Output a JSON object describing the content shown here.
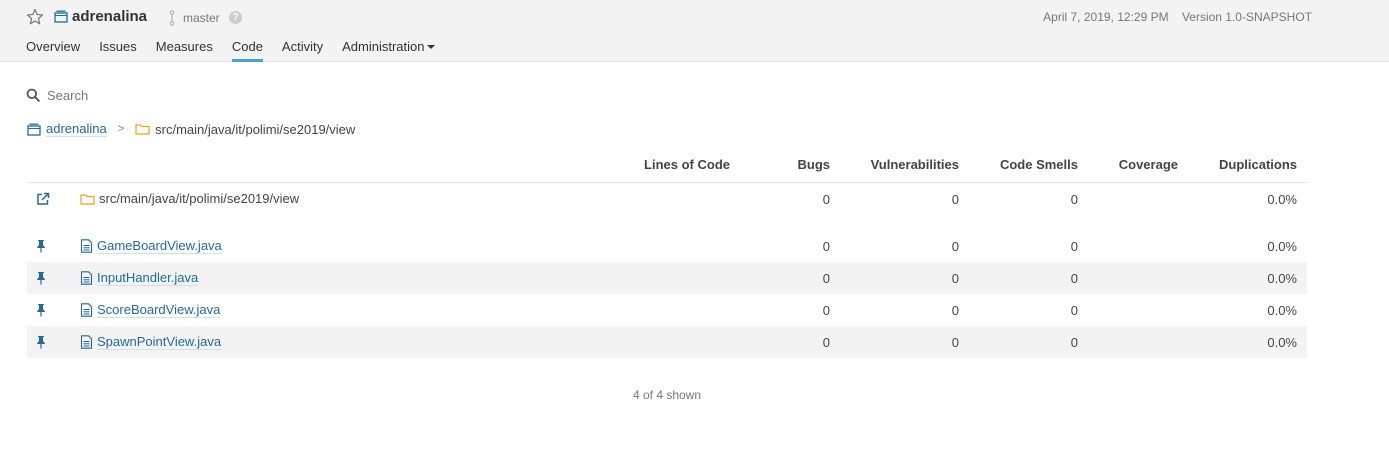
{
  "header": {
    "project_name": "adrenalina",
    "branch": "master",
    "help_glyph": "?",
    "analysis_date": "April 7, 2019, 12:29 PM",
    "version": "Version 1.0-SNAPSHOT"
  },
  "nav": [
    {
      "label": "Overview",
      "active": false
    },
    {
      "label": "Issues",
      "active": false
    },
    {
      "label": "Measures",
      "active": false
    },
    {
      "label": "Code",
      "active": true
    },
    {
      "label": "Activity",
      "active": false
    },
    {
      "label": "Administration",
      "active": false,
      "dropdown": true
    }
  ],
  "search": {
    "placeholder": "Search",
    "value": ""
  },
  "breadcrumb": {
    "project": "adrenalina",
    "separator": ">",
    "path": "src/main/java/it/polimi/se2019/view"
  },
  "table": {
    "columns": [
      "Lines of Code",
      "Bugs",
      "Vulnerabilities",
      "Code Smells",
      "Coverage",
      "Duplications"
    ],
    "base_row": {
      "name": "src/main/java/it/polimi/se2019/view",
      "lines_of_code": "",
      "bugs": "0",
      "vulnerabilities": "0",
      "code_smells": "0",
      "coverage": "",
      "duplications": "0.0%"
    },
    "rows": [
      {
        "name": "GameBoardView.java",
        "lines_of_code": "",
        "bugs": "0",
        "vulnerabilities": "0",
        "code_smells": "0",
        "coverage": "",
        "duplications": "0.0%"
      },
      {
        "name": "InputHandler.java",
        "lines_of_code": "",
        "bugs": "0",
        "vulnerabilities": "0",
        "code_smells": "0",
        "coverage": "",
        "duplications": "0.0%"
      },
      {
        "name": "ScoreBoardView.java",
        "lines_of_code": "",
        "bugs": "0",
        "vulnerabilities": "0",
        "code_smells": "0",
        "coverage": "",
        "duplications": "0.0%"
      },
      {
        "name": "SpawnPointView.java",
        "lines_of_code": "",
        "bugs": "0",
        "vulnerabilities": "0",
        "code_smells": "0",
        "coverage": "",
        "duplications": "0.0%"
      }
    ],
    "footer": "4 of 4 shown"
  },
  "colors": {
    "accent": "#4b9fd5",
    "link": "#236a97",
    "folder": "#e8a317",
    "pin": "#236a97"
  },
  "icons": [
    "star-icon",
    "project-icon",
    "branch-icon",
    "help-icon",
    "search-icon",
    "folder-icon",
    "external-link-icon",
    "pin-icon",
    "file-icon"
  ]
}
